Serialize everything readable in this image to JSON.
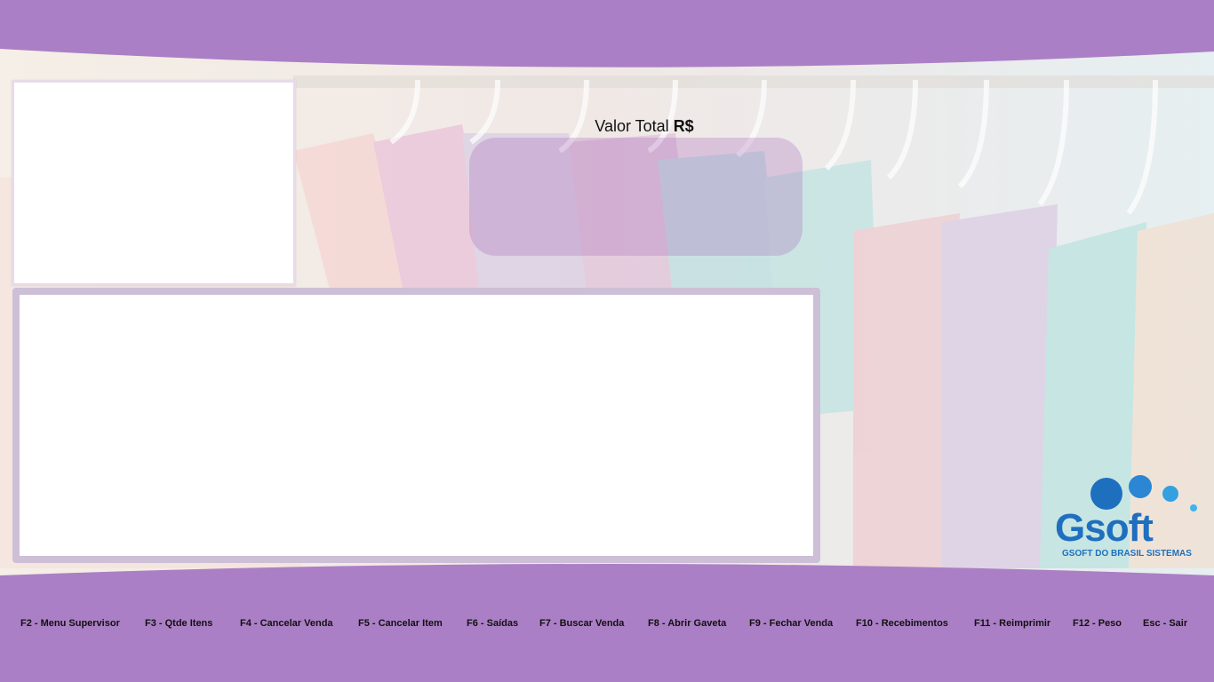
{
  "total": {
    "label": "Valor Total",
    "currency": "R$"
  },
  "logo": {
    "name": "soft",
    "initial": "G",
    "tagline": "GSOFT DO BRASIL SISTEMAS"
  },
  "function_keys": [
    {
      "label": "F2 - Menu Supervisor"
    },
    {
      "label": "F3 - Qtde Itens"
    },
    {
      "label": "F4 - Cancelar Venda"
    },
    {
      "label": "F5 - Cancelar Item"
    },
    {
      "label": "F6 - Saídas"
    },
    {
      "label": "F7 - Buscar Venda"
    },
    {
      "label": "F8 - Abrir Gaveta"
    },
    {
      "label": "F9 - Fechar Venda"
    },
    {
      "label": "F10 - Recebimentos"
    },
    {
      "label": "F11 - Reimprimir"
    },
    {
      "label": "F12 - Peso"
    },
    {
      "label": "Esc - Sair"
    }
  ],
  "colors": {
    "accent": "#ab7fc5",
    "logo_blue": "#1f6fbf"
  }
}
